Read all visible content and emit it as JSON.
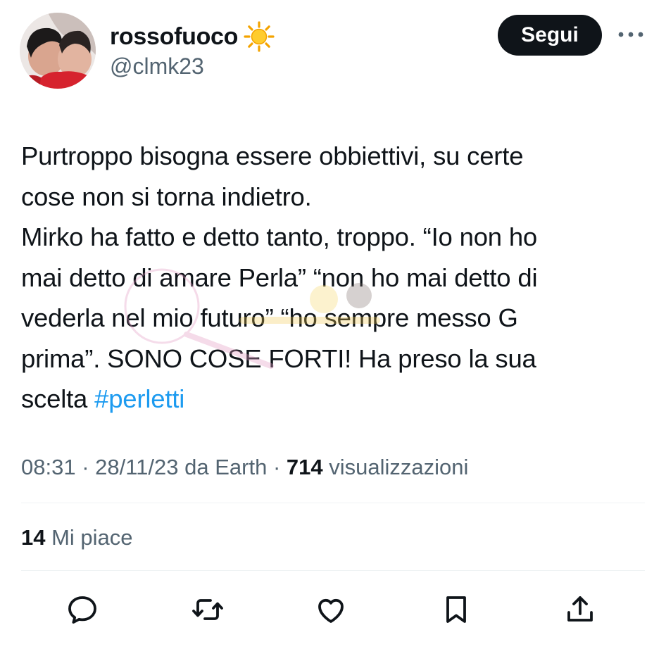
{
  "header": {
    "display_name": "rossofuoco",
    "name_emoji": "sun-emoji",
    "handle": "@clmk23",
    "follow_label": "Segui",
    "more_icon": "more-horizontal-icon"
  },
  "tweet": {
    "lines": [
      "Purtroppo bisogna essere obbiettivi, su certe",
      "cose non si torna indietro.",
      "Mirko ha fatto e detto tanto, troppo. “Io non ho",
      "mai detto di amare Perla” “non ho mai detto di",
      "vederla nel mio futuro” “ho sempre messo G",
      "prima”. SONO COSE FORTI! Ha preso la sua"
    ],
    "last_line_text": "scelta ",
    "hashtag": "#perletti"
  },
  "meta": {
    "time": "08:31",
    "separator": " · ",
    "date": "28/11/23",
    "source": " da Earth",
    "views_count": "714",
    "views_label": " visualizzazioni"
  },
  "likes": {
    "count": "14",
    "label": " Mi piace"
  },
  "actions": [
    {
      "name": "reply",
      "icon": "reply-icon"
    },
    {
      "name": "retweet",
      "icon": "retweet-icon"
    },
    {
      "name": "like",
      "icon": "heart-icon"
    },
    {
      "name": "bookmark",
      "icon": "bookmark-icon"
    },
    {
      "name": "share",
      "icon": "share-icon"
    }
  ],
  "colors": {
    "text": "#0f1419",
    "secondary": "#536471",
    "hashtag": "#1d9bf0",
    "follow_bg": "#0f1419"
  }
}
